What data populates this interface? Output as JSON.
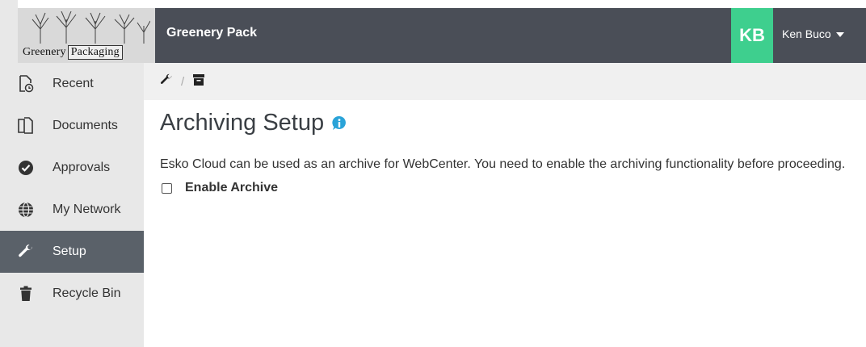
{
  "header": {
    "logo_text_left": "Greenery",
    "logo_text_right": "Packaging",
    "app_title": "Greenery Pack",
    "avatar_initials": "KB",
    "user_name": "Ken Buco",
    "header_color": "#4a4e57",
    "avatar_color": "#3ecf8e"
  },
  "sidebar": {
    "items": [
      {
        "label": "Recent",
        "icon": "recent-document-icon",
        "active": false
      },
      {
        "label": "Documents",
        "icon": "documents-icon",
        "active": false
      },
      {
        "label": "Approvals",
        "icon": "check-circle-icon",
        "active": false
      },
      {
        "label": "My Network",
        "icon": "globe-icon",
        "active": false
      },
      {
        "label": "Setup",
        "icon": "wrench-icon",
        "active": true
      },
      {
        "label": "Recycle Bin",
        "icon": "trash-icon",
        "active": false
      }
    ]
  },
  "breadcrumb": {
    "items": [
      {
        "icon": "wrench-icon"
      },
      {
        "icon": "archive-icon"
      }
    ],
    "separator": "/"
  },
  "main": {
    "title": "Archiving Setup",
    "description": "Esko Cloud can be used as an archive for WebCenter. You need to enable the archiving functionality before proceeding.",
    "checkbox_label": "Enable Archive",
    "checkbox_checked": false
  }
}
